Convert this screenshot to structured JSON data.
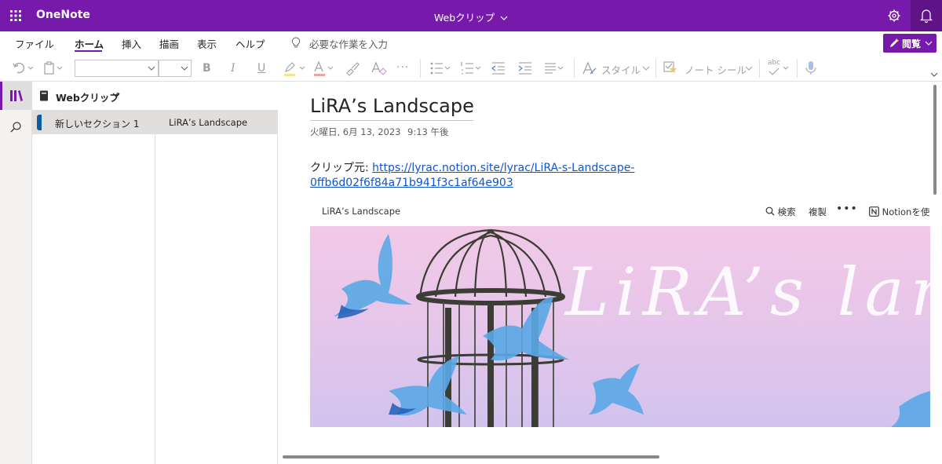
{
  "titlebar": {
    "app_name": "OneNote",
    "notebook_title": "Webクリップ",
    "accent": "#7719aa"
  },
  "menu": {
    "items": [
      "ファイル",
      "ホーム",
      "挿入",
      "描画",
      "表示",
      "ヘルプ"
    ],
    "active": "ホーム",
    "tell_me": "必要な作業を入力",
    "view_button": "閲覧"
  },
  "ribbon": {
    "icons": [
      "undo-icon",
      "paste-icon",
      "font-name-combo",
      "font-size-combo",
      "bold-icon",
      "italic-icon",
      "underline-icon",
      "highlight-icon",
      "font-color-icon",
      "format-painter-icon",
      "clear-format-icon",
      "more-icon",
      "bullets-icon",
      "numbering-icon",
      "outdent-icon",
      "indent-icon",
      "align-icon",
      "styles-icon",
      "tags-icon",
      "spelling-icon",
      "dictate-icon"
    ],
    "styles_label": "スタイル",
    "tags_label": "ノート シール",
    "spelling_label": "abc"
  },
  "navigation": {
    "notebook_name": "Webクリップ",
    "section": "新しいセクション 1",
    "page": "LiRA’s Landscape"
  },
  "page": {
    "title": "LiRA’s Landscape",
    "date": "火曜日, 6月 13, 2023",
    "time": "9:13 午後",
    "clip_source_label": "クリップ元: ",
    "clip_url": "https://lyrac.notion.site/lyrac/LiRA-s-Landscape-0ffb6d02f6f84a71b941f3c1af64e903"
  },
  "clip_image": {
    "breadcrumb": "LiRA’s Landscape",
    "search": "検索",
    "duplicate": "複製",
    "more": "•••",
    "use_notion": "Notionを使",
    "banner_text": "LiRA’s landsc"
  }
}
